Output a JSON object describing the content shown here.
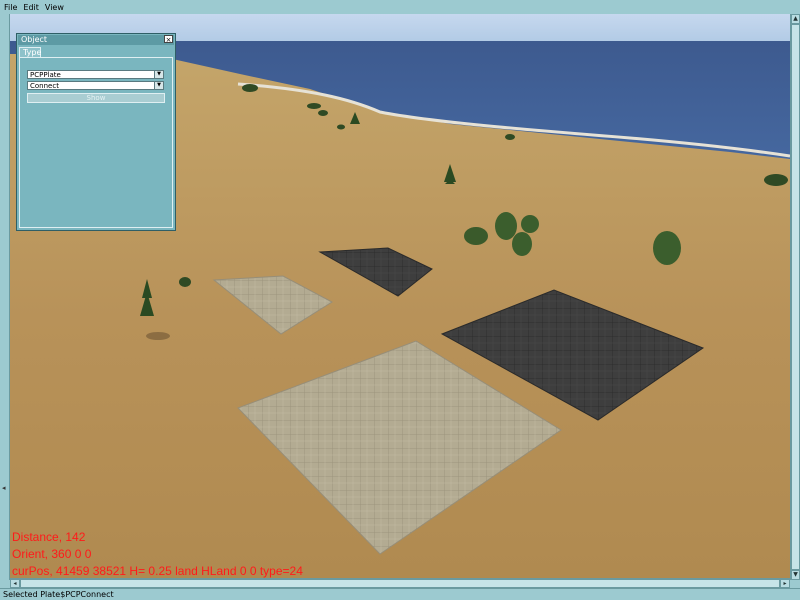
{
  "menu": {
    "items": [
      "File",
      "Edit",
      "View"
    ]
  },
  "object_panel": {
    "title": "Object",
    "close_glyph": "×",
    "tab_label": "Type",
    "type_select_value": "PCPPlate",
    "mode_select_value": "Connect",
    "show_button_label": "Show"
  },
  "overlay": {
    "distance": "Distance, 142",
    "orient": "Orient, 360 0 0",
    "curpos": "curPos, 41459 38521 H= 0.25 land HLand 0 0 type=24"
  },
  "status": {
    "text": "Selected Plate$PCPConnect"
  },
  "colors": {
    "overlay_text": "#ff1a1a",
    "chrome": "#9ccad0",
    "panel": "#7ab6bf"
  }
}
